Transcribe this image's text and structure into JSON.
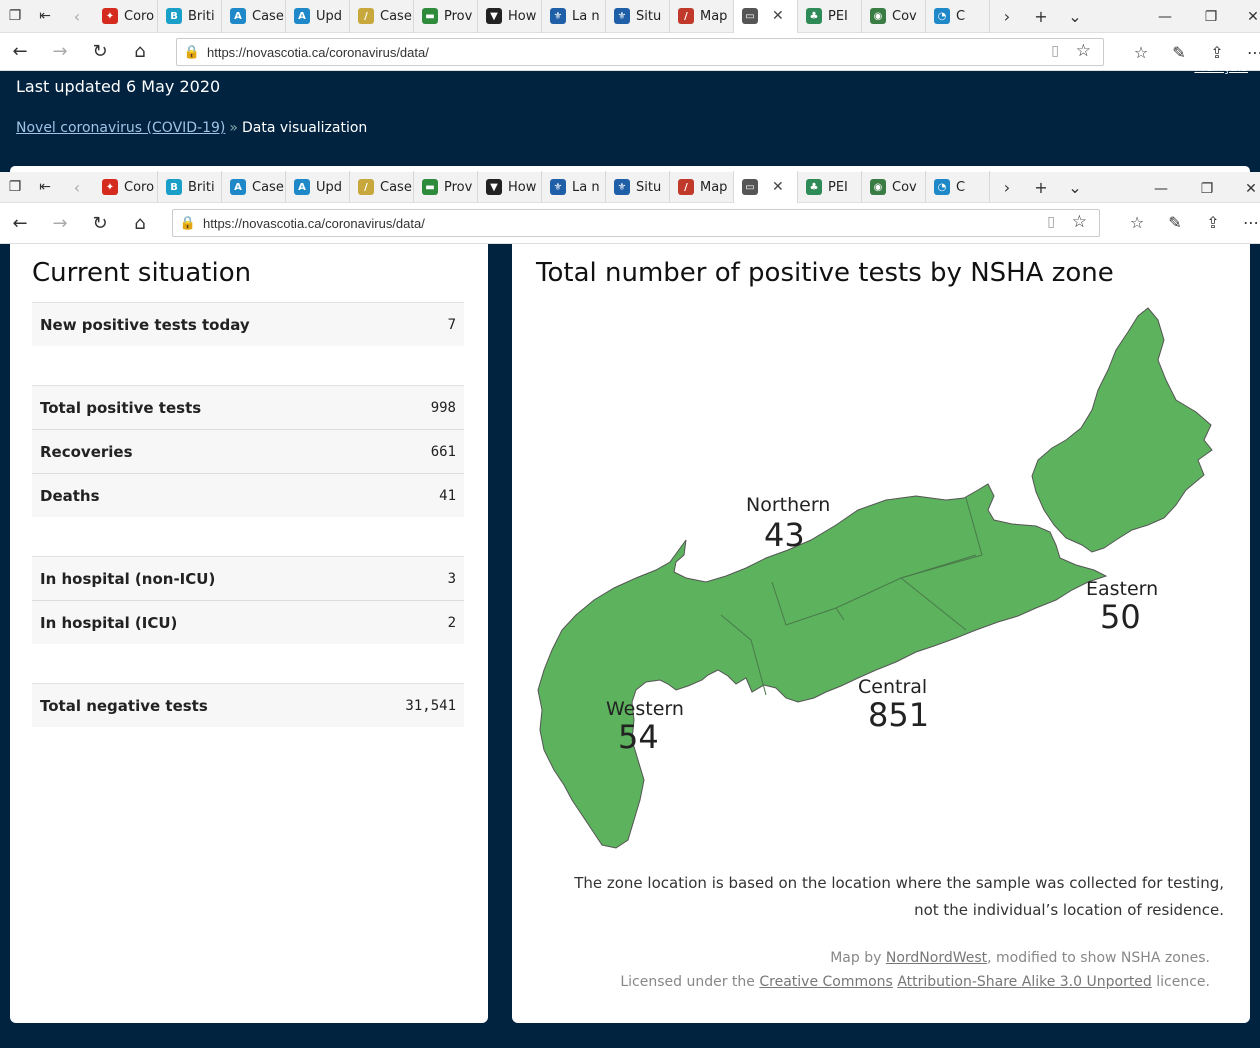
{
  "browser": {
    "url": "https://novascotia.ca/coronavirus/data/",
    "tabs": [
      {
        "label": "Coro",
        "color": "#d52b1e",
        "glyph": "✦"
      },
      {
        "label": "Briti",
        "color": "#1aa0c8",
        "glyph": "B"
      },
      {
        "label": "Case",
        "color": "#1e88c8",
        "glyph": "A"
      },
      {
        "label": "Upd",
        "color": "#1e88c8",
        "glyph": "A"
      },
      {
        "label": "Case",
        "color": "#c8a83c",
        "glyph": "/"
      },
      {
        "label": "Prov",
        "color": "#2e8b3c",
        "glyph": "▬"
      },
      {
        "label": "How",
        "color": "#222222",
        "glyph": "▼"
      },
      {
        "label": "La n",
        "color": "#1f5fa8",
        "glyph": "⚜"
      },
      {
        "label": "Situ",
        "color": "#1f5fa8",
        "glyph": "⚜"
      },
      {
        "label": "Map",
        "color": "#c0392b",
        "glyph": "/"
      },
      {
        "label": "",
        "color": "#555555",
        "glyph": "▭",
        "active": true
      },
      {
        "label": "PEI",
        "color": "#2e8b57",
        "glyph": "♣"
      },
      {
        "label": "Cov",
        "color": "#3a7d44",
        "glyph": "◉"
      },
      {
        "label": "C",
        "color": "#1e88c8",
        "glyph": "◔"
      }
    ]
  },
  "header": {
    "updated": "Last updated 6 May 2020",
    "francais": "Français",
    "breadcrumb_link": "Novel coronavirus (COVID-19)",
    "breadcrumb_sep": "»",
    "breadcrumb_current": "Data visualization"
  },
  "current": {
    "title": "Current situation",
    "groups": [
      [
        {
          "label": "New positive tests today",
          "value": "7"
        }
      ],
      [
        {
          "label": "Total positive tests",
          "value": "998"
        },
        {
          "label": "Recoveries",
          "value": "661"
        },
        {
          "label": "Deaths",
          "value": "41"
        }
      ],
      [
        {
          "label": "In hospital (non-ICU)",
          "value": "3"
        },
        {
          "label": "In hospital (ICU)",
          "value": "2"
        }
      ],
      [
        {
          "label": "Total negative tests",
          "value": "31,541"
        }
      ]
    ]
  },
  "map": {
    "title": "Total number of positive tests by NSHA zone",
    "fill_color": "#5cb25d",
    "zones": [
      {
        "name": "Northern",
        "count": "43"
      },
      {
        "name": "Eastern",
        "count": "50"
      },
      {
        "name": "Central",
        "count": "851"
      },
      {
        "name": "Western",
        "count": "54"
      }
    ],
    "note_line1": "The zone location is based on the location where the sample was collected for testing,",
    "note_line2": "not the individual’s location of residence.",
    "credit_prefix": "Map by ",
    "credit_author": "NordNordWest",
    "credit_suffix": ", modified to show NSHA zones.",
    "license_prefix": "Licensed under the ",
    "license_link1": "Creative Commons",
    "license_link2": "Attribution-Share Alike 3.0 Unported",
    "license_suffix": " licence."
  }
}
